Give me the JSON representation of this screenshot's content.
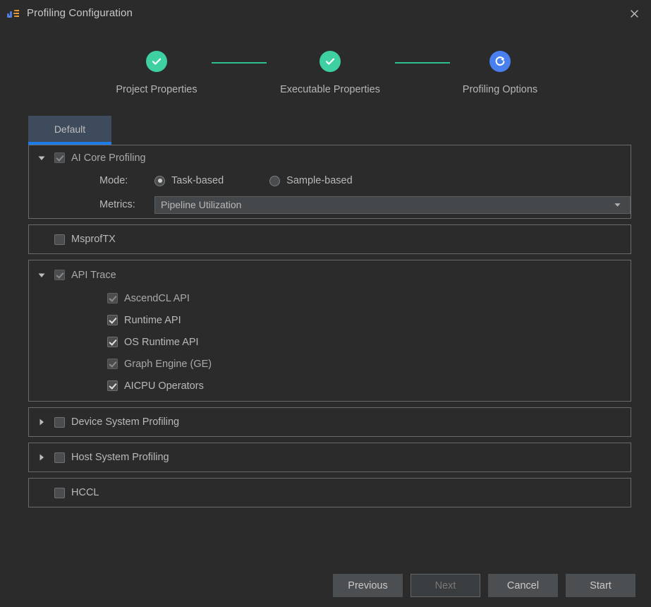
{
  "window": {
    "title": "Profiling Configuration",
    "icon": "profiling-app-icon",
    "close_label": "×"
  },
  "stepper": {
    "steps": [
      {
        "label": "Project Properties",
        "state": "complete",
        "icon": "check-icon"
      },
      {
        "label": "Executable Properties",
        "state": "complete",
        "icon": "check-icon"
      },
      {
        "label": "Profiling Options",
        "state": "current",
        "icon": "refresh-spinner-icon"
      }
    ],
    "colors": {
      "complete": "#3ed0a2",
      "current": "#4a7ff0",
      "connector": "#2fbe92"
    }
  },
  "tabs": [
    {
      "label": "Default",
      "selected": true,
      "accent": "#1e7ce8"
    }
  ],
  "panels": [
    {
      "id": "ai-core-profiling",
      "expandable": true,
      "expanded": true,
      "toggle_icon": "chevron-down-icon",
      "checkbox": {
        "checked": true,
        "disabled": true
      },
      "label": "AI Core Profiling",
      "fields": {
        "mode_label": "Mode:",
        "mode_options": [
          {
            "label": "Task-based",
            "selected": true
          },
          {
            "label": "Sample-based",
            "selected": false
          }
        ],
        "metrics_label": "Metrics:",
        "metrics_value": "Pipeline Utilization",
        "metrics_arrow_icon": "chevron-down-icon"
      }
    },
    {
      "id": "msproftx",
      "expandable": false,
      "checkbox": {
        "checked": false,
        "disabled": false
      },
      "label": "MsprofTX"
    },
    {
      "id": "api-trace",
      "expandable": true,
      "expanded": true,
      "toggle_icon": "chevron-down-icon",
      "checkbox": {
        "checked": true,
        "disabled": true
      },
      "label": "API Trace",
      "children": [
        {
          "label": "AscendCL API",
          "checked": true,
          "disabled": true
        },
        {
          "label": "Runtime API",
          "checked": true,
          "disabled": false
        },
        {
          "label": "OS Runtime API",
          "checked": true,
          "disabled": false
        },
        {
          "label": "Graph Engine (GE)",
          "checked": true,
          "disabled": true
        },
        {
          "label": "AICPU Operators",
          "checked": true,
          "disabled": false
        }
      ]
    },
    {
      "id": "device-system-profiling",
      "expandable": true,
      "expanded": false,
      "toggle_icon": "chevron-right-icon",
      "checkbox": {
        "checked": false,
        "disabled": false
      },
      "label": "Device System Profiling"
    },
    {
      "id": "host-system-profiling",
      "expandable": true,
      "expanded": false,
      "toggle_icon": "chevron-right-icon",
      "checkbox": {
        "checked": false,
        "disabled": false
      },
      "label": "Host System Profiling"
    },
    {
      "id": "hccl",
      "expandable": false,
      "checkbox": {
        "checked": false,
        "disabled": false
      },
      "label": "HCCL"
    }
  ],
  "footer": {
    "buttons": [
      {
        "label": "Previous",
        "disabled": false
      },
      {
        "label": "Next",
        "disabled": true
      },
      {
        "label": "Cancel",
        "disabled": false
      },
      {
        "label": "Start",
        "disabled": false
      }
    ]
  }
}
